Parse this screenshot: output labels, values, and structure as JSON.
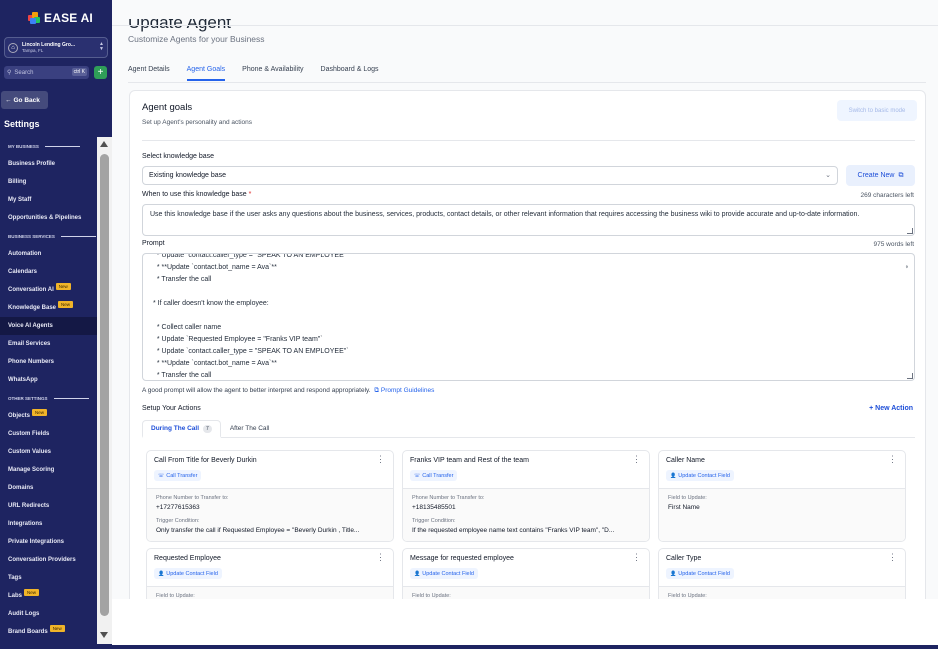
{
  "brand": {
    "name": "EASE AI"
  },
  "location": {
    "name": "Lincoln Lending Gro...",
    "city": "Tampa, FL"
  },
  "search": {
    "placeholder": "Search",
    "shortcut": "ctrl K"
  },
  "sidebar": {
    "go_back": "Go Back",
    "title": "Settings",
    "sections": [
      {
        "label": "MY BUSINESS",
        "items": [
          {
            "label": "Business Profile"
          },
          {
            "label": "Billing"
          },
          {
            "label": "My Staff"
          },
          {
            "label": "Opportunities & Pipelines"
          }
        ]
      },
      {
        "label": "BUSINESS SERVICES",
        "items": [
          {
            "label": "Automation"
          },
          {
            "label": "Calendars"
          },
          {
            "label": "Conversation AI",
            "badge": "New"
          },
          {
            "label": "Knowledge Base",
            "badge": "New"
          },
          {
            "label": "Voice AI Agents",
            "active": true
          },
          {
            "label": "Email Services"
          },
          {
            "label": "Phone Numbers"
          },
          {
            "label": "WhatsApp"
          }
        ]
      },
      {
        "label": "OTHER SETTINGS",
        "items": [
          {
            "label": "Objects",
            "badge": "New"
          },
          {
            "label": "Custom Fields"
          },
          {
            "label": "Custom Values"
          },
          {
            "label": "Manage Scoring"
          },
          {
            "label": "Domains"
          },
          {
            "label": "URL Redirects"
          },
          {
            "label": "Integrations"
          },
          {
            "label": "Private Integrations"
          },
          {
            "label": "Conversation Providers"
          },
          {
            "label": "Tags"
          },
          {
            "label": "Labs",
            "badge": "New"
          },
          {
            "label": "Audit Logs"
          },
          {
            "label": "Brand Boards",
            "badge": "New"
          }
        ]
      }
    ]
  },
  "page": {
    "title": "Update Agent",
    "subtitle": "Customize Agents for your Business"
  },
  "tabs": [
    {
      "label": "Agent Details",
      "active": false
    },
    {
      "label": "Agent Goals",
      "active": true
    },
    {
      "label": "Phone & Availability",
      "active": false
    },
    {
      "label": "Dashboard & Logs",
      "active": false
    }
  ],
  "goals": {
    "title": "Agent goals",
    "subtitle": "Set up Agent's personality and actions",
    "basic_mode": "Switch to basic mode",
    "kb_label": "Select knowledge base",
    "kb_value": "Existing knowledge base",
    "create_new": "Create New",
    "when_label": "When to use this knowledge base",
    "when_required": "*",
    "when_chars_left": "269 characters left",
    "when_text": "Use this knowledge base if the user asks any questions about the business, services, products, contact details, or other relevant information that requires accessing the business wiki to provide accurate and up-to-date information.",
    "prompt_label": "Prompt",
    "prompt_words_left": "975 words left",
    "prompt_lines": [
      "  * Update `contact.caller_type = \"SPEAK TO AN EMPLOYEE\"`",
      "  * **Update `contact.bot_name = Ava`**",
      "  * Transfer the call",
      "",
      "* If caller doesn't know the employee:",
      "",
      "  * Collect caller name",
      "  * Update `Requested Employee = \"Franks VIP team\"`",
      "  * Update `contact.caller_type = \"SPEAK TO AN EMPLOYEE\"`",
      "  * **Update `contact.bot_name = Ava`**",
      "  * Transfer the call"
    ],
    "prompt_hint": "A good prompt will allow the agent to better interpret and respond appropriately.",
    "prompt_link": "Prompt Guidelines",
    "setup_title": "Setup Your Actions",
    "new_action": "+  New Action",
    "action_tabs": [
      {
        "label": "During The Call",
        "count": "7",
        "active": true
      },
      {
        "label": "After The Call",
        "count": "",
        "active": false
      }
    ]
  },
  "actions": [
    {
      "title": "Call From Title for Beverly Durkin",
      "type": "Call Transfer",
      "field1_label": "Phone Number to Transfer to:",
      "field1_value": "+17277615363",
      "field2_label": "Trigger Condition:",
      "field2_value": "Only transfer the call if Requested Employee = \"Beverly Durkin , Title..."
    },
    {
      "title": "Franks VIP team and Rest of the team",
      "type": "Call Transfer",
      "field1_label": "Phone Number to Transfer to:",
      "field1_value": "+18135485501",
      "field2_label": "Trigger Condition:",
      "field2_value": "If the requested employee name text contains \"Franks VIP team\", \"D..."
    },
    {
      "title": "Caller Name",
      "type": "Update Contact Field",
      "field1_label": "Field to Update:",
      "field1_value": "First Name",
      "field2_label": "",
      "field2_value": ""
    },
    {
      "title": "Requested Employee",
      "type": "Update Contact Field",
      "field1_label": "Field to Update:",
      "field1_value": "",
      "field2_label": "",
      "field2_value": ""
    },
    {
      "title": "Message for requested employee",
      "type": "Update Contact Field",
      "field1_label": "Field to Update:",
      "field1_value": "",
      "field2_label": "",
      "field2_value": ""
    },
    {
      "title": "Caller Type",
      "type": "Update Contact Field",
      "field1_label": "Field to Update:",
      "field1_value": "",
      "field2_label": "",
      "field2_value": ""
    }
  ],
  "colors": {
    "sidebar": "#1e2461",
    "accent": "#2563eb",
    "badge": "#f0b429"
  }
}
